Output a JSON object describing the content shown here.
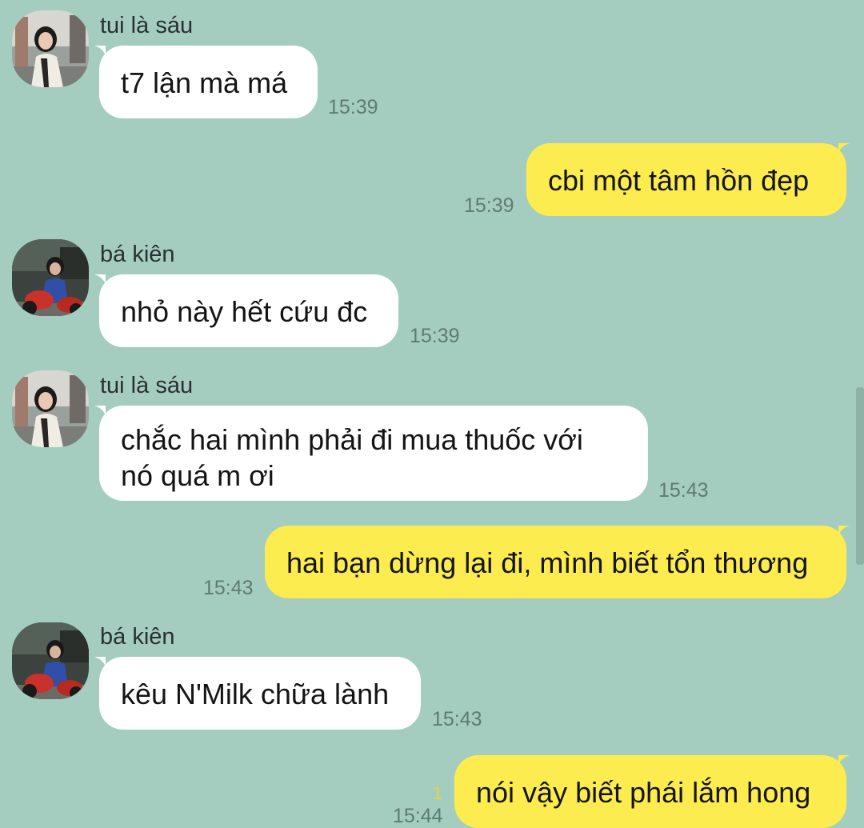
{
  "colors": {
    "background": "#a4cdc0",
    "incoming_bubble": "#ffffff",
    "outgoing_bubble": "#fdec4f",
    "timestamp": "#5f7a72",
    "unread_count": "#e6d632"
  },
  "messages": [
    {
      "direction": "in",
      "sender": "tui là sáu",
      "avatar": "avatar-girl-photo",
      "text": "t7 lận mà má",
      "time": "15:39"
    },
    {
      "direction": "out",
      "text": "cbi một tâm hồn đẹp",
      "time": "15:39"
    },
    {
      "direction": "in",
      "sender": "bá kiên",
      "avatar": "avatar-boy-motorbike-photo",
      "text": "nhỏ này hết cứu đc",
      "time": "15:39"
    },
    {
      "direction": "in",
      "sender": "tui là sáu",
      "avatar": "avatar-girl-photo",
      "text_line1": "chắc hai mình phải đi mua thuốc với",
      "text_line2": "nó quá m ơi",
      "time": "15:43"
    },
    {
      "direction": "out",
      "text": "hai bạn dừng lại đi, mình biết tổn thương",
      "time": "15:43"
    },
    {
      "direction": "in",
      "sender": "bá kiên",
      "avatar": "avatar-boy-motorbike-photo",
      "text": "kêu N'Milk chữa lành",
      "time": "15:43"
    },
    {
      "direction": "out",
      "text": "nói vậy biết phái lắm hong",
      "time": "15:44",
      "unread": "1"
    }
  ]
}
